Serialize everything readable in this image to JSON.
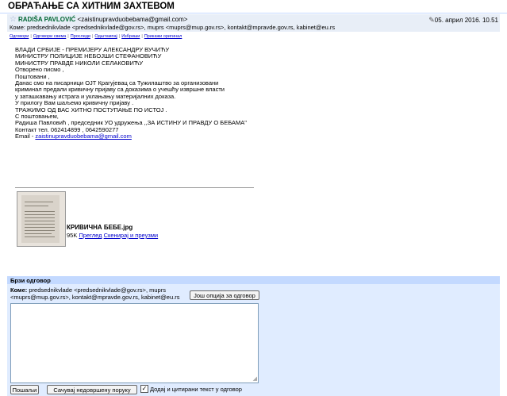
{
  "subject": "ОБРАЋАЊЕ СА ХИТНИМ ЗАХТЕВОМ",
  "header": {
    "sender_name": "RADIŠA PAVLOVIĆ",
    "sender_email": "<zaistinupravduobebama@gmail.com>",
    "date": "05. април 2016. 10.51",
    "to_line": "Коме: predsednikvlade <predsednikvlade@gov.rs>, muprs <muprs@mup.gov.rs>, kontakt@mpravde.gov.rs, kabinet@eu.rs"
  },
  "actions": [
    "Одговори",
    "Одговори свима",
    "Проследи",
    "Одштампај",
    "Избриши",
    "Прикажи оригинал"
  ],
  "body": [
    "ВЛАДИ СРБИЈЕ - ПРЕМИЈЕРУ АЛЕКСАНДРУ ВУЧИЋУ",
    "МИНИСТРУ ПОЛИЦИЈЕ НЕБОЈШИ СТЕФАНОВИЋУ",
    "МИНИСТРУ ПРАВДЕ НИКОЛИ СЕЛАКОВИЋУ",
    "",
    "Отворено писмо ,",
    "",
    "Поштовани ,",
    "",
    "Данас смо на писарници ОЈТ Крагујевац са Тужилаштво за организовани",
    "криминал предали кривичну пријаву са доказима о учешћу извршне власти",
    "у заташкавању истрага и уклањању материјалних доказа.",
    "У прилогу Вам шаљемо кривичну пријаву .",
    "ТРАЖИМО ОД ВАС ХИТНО ПОСТУПАЊЕ ПО ИСТОЈ .",
    "",
    "С поштовањем,",
    "",
    "Радиша Павловић , председник УО удружења ,,ЗА ИСТИНУ И ПРАВДУ О БЕБАМА\"",
    "Контакт тел. 062414899 , 0642590277"
  ],
  "email_line": {
    "prefix": "Email - ",
    "address": "zaistinupravduobebama@gmail.com"
  },
  "attachment": {
    "filename": "КРИВИЧНА БЕБЕ.jpg",
    "size": "95K",
    "view_link": "Преглед",
    "download_link": "Скенирај и преузми"
  },
  "quick_reply": {
    "title": "Брзи одговор",
    "to_label": "Коме:",
    "to_value": "predsednikvlade <predsednikvlade@gov.rs>, muprs <muprs@mup.gov.rs>, kontakt@mpravde.gov.rs, kabinet@eu.rs",
    "more_options": "Још опција за одговор",
    "send": "Пошаљи",
    "save_draft": "Сачувај недовршену поруку",
    "include_quote": "Додај и цитирани текст у одговор",
    "include_quote_checked": true
  }
}
